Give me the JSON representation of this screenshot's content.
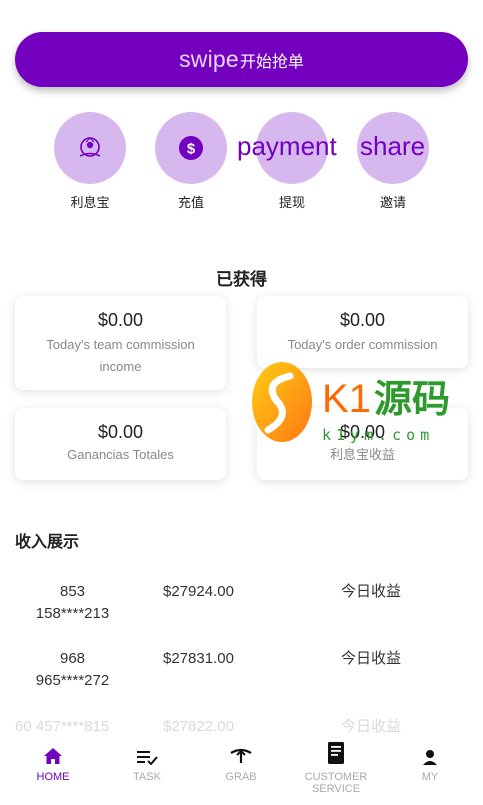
{
  "swipe": {
    "word": "swipe",
    "label": "开始抢单"
  },
  "quick_actions": [
    {
      "label": "利息宝",
      "icon": "interest-treasure-icon"
    },
    {
      "label": "充值",
      "icon": "dollar-coin-icon"
    },
    {
      "label": "提现",
      "icon": "withdraw-icon"
    },
    {
      "label": "邀请",
      "icon": "invite-icon"
    }
  ],
  "overlay_words": {
    "payment": "payment",
    "share": "share"
  },
  "earned": {
    "title": "已获得",
    "cards": [
      {
        "value": "$0.00",
        "label": "Today's team commission income"
      },
      {
        "value": "$0.00",
        "label": "Today's order commission"
      },
      {
        "value": "$0.00",
        "label": "Ganancias Totales"
      },
      {
        "value": "$0.00",
        "label": "利息宝收益"
      }
    ]
  },
  "income": {
    "title": "收入展示",
    "rows": [
      {
        "num": "853",
        "user": "158****213",
        "amount": "$27924.00",
        "note": "今日收益"
      },
      {
        "num": "968",
        "user": "965****272",
        "amount": "$27831.00",
        "note": "今日收益"
      },
      {
        "num": "60",
        "user": "457****815",
        "amount": "$27822.00",
        "note": "今日收益"
      }
    ]
  },
  "watermark": {
    "brand_k1": "K1",
    "brand_cn": "源码",
    "domain": "k1ym.com"
  },
  "tabs": [
    {
      "label": "HOME",
      "icon": "home-icon",
      "active": true
    },
    {
      "label": "TASK",
      "icon": "task-icon",
      "active": false
    },
    {
      "label": "GRAB",
      "icon": "grab-icon",
      "active": false
    },
    {
      "label": "CUSTOMER SERVICE",
      "icon": "customer-service-icon",
      "active": false
    },
    {
      "label": "MY",
      "icon": "user-icon",
      "active": false
    }
  ],
  "colors": {
    "accent": "#7200be",
    "circle": "#d6b8ef"
  }
}
